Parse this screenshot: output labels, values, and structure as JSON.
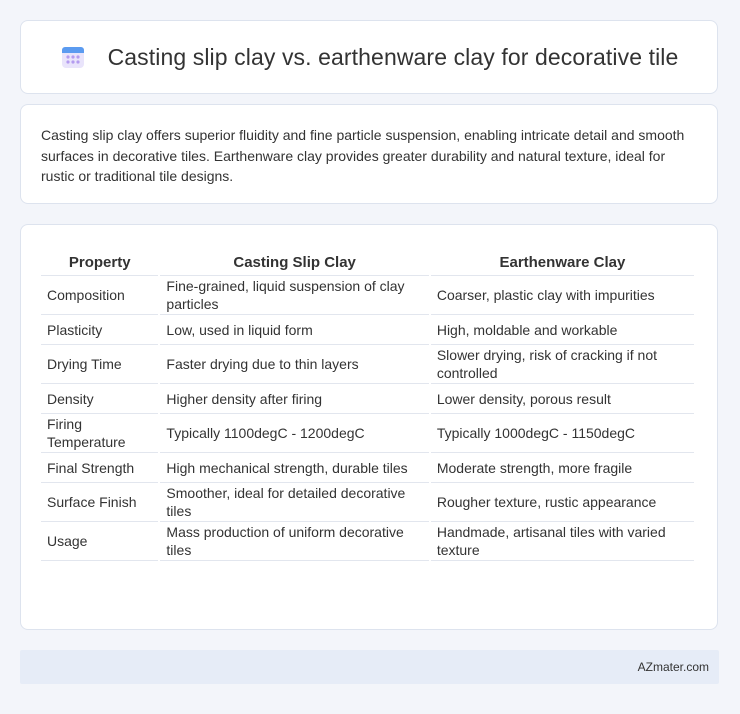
{
  "header": {
    "title": "Casting slip clay vs. earthenware clay for decorative tile",
    "icon": "calendar-icon"
  },
  "summary": {
    "text": "Casting slip clay offers superior fluidity and fine particle suspension, enabling intricate detail and smooth surfaces in decorative tiles. Earthenware clay provides greater durability and natural texture, ideal for rustic or traditional tile designs."
  },
  "table": {
    "headers": [
      "Property",
      "Casting Slip Clay",
      "Earthenware Clay"
    ],
    "rows": [
      [
        "Composition",
        "Fine-grained, liquid suspension of clay particles",
        "Coarser, plastic clay with impurities"
      ],
      [
        "Plasticity",
        "Low, used in liquid form",
        "High, moldable and workable"
      ],
      [
        "Drying Time",
        "Faster drying due to thin layers",
        "Slower drying, risk of cracking if not controlled"
      ],
      [
        "Density",
        "Higher density after firing",
        "Lower density, porous result"
      ],
      [
        "Firing Temperature",
        "Typically 1100degC - 1200degC",
        "Typically 1000degC - 1150degC"
      ],
      [
        "Final Strength",
        "High mechanical strength, durable tiles",
        "Moderate strength, more fragile"
      ],
      [
        "Surface Finish",
        "Smoother, ideal for detailed decorative tiles",
        "Rougher texture, rustic appearance"
      ],
      [
        "Usage",
        "Mass production of uniform decorative tiles",
        "Handmade, artisanal tiles with varied texture"
      ]
    ]
  },
  "footer": {
    "brand": "AZmater.com"
  },
  "colors": {
    "page_bg": "#f3f5fa",
    "card_border": "#dde3ee",
    "footer_bg": "#e6ecf7",
    "icon_accent": "#7b68ee"
  }
}
